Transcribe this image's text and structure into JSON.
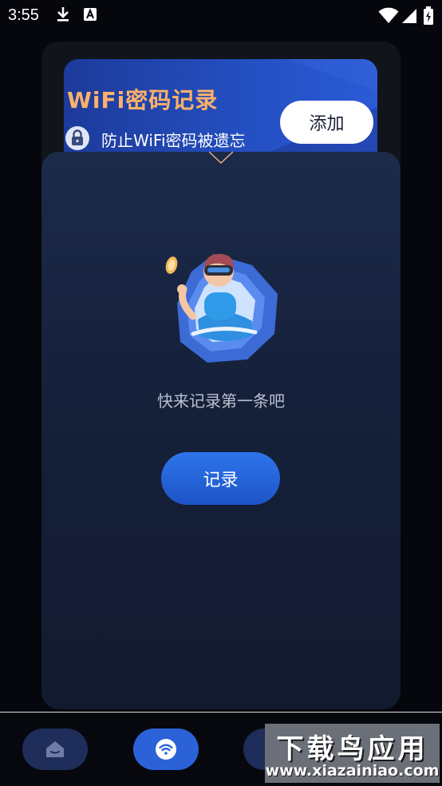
{
  "status_bar": {
    "time": "3:55",
    "icons": [
      "download-icon",
      "keyboard-a-icon",
      "wifi-signal-icon",
      "cell-signal-icon",
      "battery-icon"
    ]
  },
  "banner": {
    "title": "WiFi密码记录",
    "subtitle": "防止WiFi密码被遗忘",
    "add_label": "添加"
  },
  "empty_state": {
    "message": "快来记录第一条吧",
    "record_label": "记录"
  },
  "bottom_nav": {
    "items": [
      {
        "icon": "home-icon",
        "active": false
      },
      {
        "icon": "wifi-icon",
        "active": true
      },
      {
        "icon": "nav-item-icon",
        "active": false
      }
    ]
  },
  "watermark": {
    "title": "下载鸟应用",
    "url": "www.xiazainiao.com"
  },
  "colors": {
    "banner_title": "#ffb169",
    "accent": "#2b62d8",
    "panel": "#172340"
  }
}
